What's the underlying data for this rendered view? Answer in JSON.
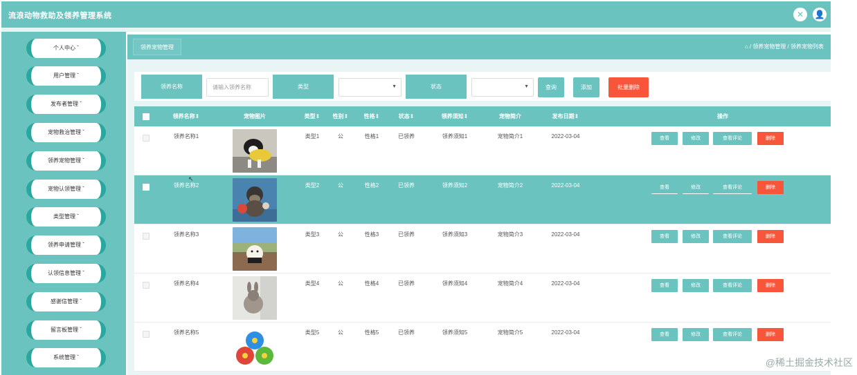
{
  "app": {
    "title": "流浪动物救助及领养管理系统"
  },
  "top_icons": {
    "fullscreen": "✕",
    "user": "👤"
  },
  "sidebar": {
    "items": [
      {
        "label": "个人中心 ˇ"
      },
      {
        "label": "用户管理 ˇ"
      },
      {
        "label": "发布者管理 ˇ"
      },
      {
        "label": "宠物救治管理 ˇ"
      },
      {
        "label": "领养宠物管理 ˇ"
      },
      {
        "label": "宠物认领管理 ˇ"
      },
      {
        "label": "类型管理 ˇ"
      },
      {
        "label": "领养申请管理 ˇ"
      },
      {
        "label": "认领信息管理 ˇ"
      },
      {
        "label": "感谢信管理 ˇ"
      },
      {
        "label": "留言板管理 ˇ"
      },
      {
        "label": "系统管理 ˇ"
      }
    ]
  },
  "breadcrumb": {
    "title": "领养宠物管理",
    "path": "⌂ / 领养宠物管理 / 领养宠物列表"
  },
  "search": {
    "name_label": "领养名称",
    "name_placeholder": "请输入领养名称",
    "type_label": "类型",
    "status_label": "状态",
    "search_btn": "查询",
    "add_btn": "添加",
    "batch_delete_btn": "批量删除"
  },
  "table": {
    "headers": {
      "name": "领养名称⇕",
      "image": "宠物图片",
      "type": "类型⇕",
      "gender": "性别⇕",
      "character": "性格⇕",
      "status": "状态⇕",
      "notice": "领养须知⇕",
      "intro": "宠物简介",
      "date": "发布日期⇕",
      "actions": "操作"
    },
    "rows": [
      {
        "name": "领养名称1",
        "type": "类型1",
        "gender": "公",
        "character": "性格1",
        "status": "已领养",
        "notice": "领养须知1",
        "intro": "宠物简介1",
        "date": "2022-03-04"
      },
      {
        "name": "领养名称2",
        "type": "类型2",
        "gender": "公",
        "character": "性格2",
        "status": "已领养",
        "notice": "领养须知2",
        "intro": "宠物简介2",
        "date": "2022-03-04"
      },
      {
        "name": "领养名称3",
        "type": "类型3",
        "gender": "公",
        "character": "性格3",
        "status": "已领养",
        "notice": "领养须知3",
        "intro": "宠物简介3",
        "date": "2022-03-04"
      },
      {
        "name": "领养名称4",
        "type": "类型4",
        "gender": "公",
        "character": "性格4",
        "status": "已领养",
        "notice": "领养须知4",
        "intro": "宠物简介4",
        "date": "2022-03-04"
      },
      {
        "name": "领养名称5",
        "type": "类型5",
        "gender": "公",
        "character": "性格5",
        "status": "已领养",
        "notice": "领养须知5",
        "intro": "宠物简介5",
        "date": "2022-03-04"
      }
    ],
    "actions": {
      "view": "查看",
      "edit": "修改",
      "comments": "查看评论",
      "delete": "删除"
    }
  },
  "watermark": "@稀土掘金技术社区",
  "colors": {
    "primary": "#6bc3c0",
    "danger": "#f7563a"
  }
}
